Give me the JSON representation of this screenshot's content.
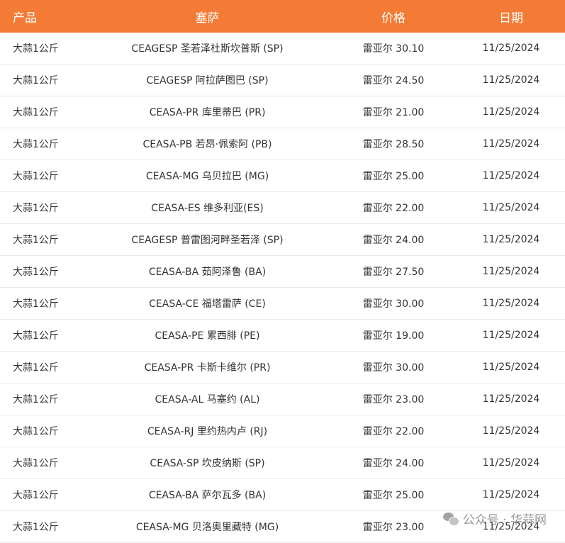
{
  "table": {
    "headers": {
      "product": "产品",
      "market": "塞萨",
      "price": "价格",
      "date": "日期"
    },
    "rows": [
      {
        "product": "大蒜1公斤",
        "market": "CEAGESP 圣若泽杜斯坎普斯 (SP)",
        "price": "雷亚尔 30.10",
        "date": "11/25/2024"
      },
      {
        "product": "大蒜1公斤",
        "market": "CEAGESP 阿拉萨图巴 (SP)",
        "price": "雷亚尔 24.50",
        "date": "11/25/2024"
      },
      {
        "product": "大蒜1公斤",
        "market": "CEASA-PR 库里蒂巴 (PR)",
        "price": "雷亚尔 21.00",
        "date": "11/25/2024"
      },
      {
        "product": "大蒜1公斤",
        "market": "CEASA-PB 若昂·佩索阿 (PB)",
        "price": "雷亚尔 28.50",
        "date": "11/25/2024"
      },
      {
        "product": "大蒜1公斤",
        "market": "CEASA-MG 乌贝拉巴 (MG)",
        "price": "雷亚尔 25.00",
        "date": "11/25/2024"
      },
      {
        "product": "大蒜1公斤",
        "market": "CEASA-ES 维多利亚(ES)",
        "price": "雷亚尔 22.00",
        "date": "11/25/2024"
      },
      {
        "product": "大蒜1公斤",
        "market": "CEAGESP 普雷图河畔圣若泽 (SP)",
        "price": "雷亚尔 24.00",
        "date": "11/25/2024"
      },
      {
        "product": "大蒜1公斤",
        "market": "CEASA-BA 茹阿泽鲁 (BA)",
        "price": "雷亚尔 27.50",
        "date": "11/25/2024"
      },
      {
        "product": "大蒜1公斤",
        "market": "CEASA-CE 福塔雷萨 (CE)",
        "price": "雷亚尔 30.00",
        "date": "11/25/2024"
      },
      {
        "product": "大蒜1公斤",
        "market": "CEASA-PE 累西腓 (PE)",
        "price": "雷亚尔 19.00",
        "date": "11/25/2024"
      },
      {
        "product": "大蒜1公斤",
        "market": "CEASA-PR 卡斯卡维尔 (PR)",
        "price": "雷亚尔 30.00",
        "date": "11/25/2024"
      },
      {
        "product": "大蒜1公斤",
        "market": "CEASA-AL 马塞约 (AL)",
        "price": "雷亚尔 23.00",
        "date": "11/25/2024"
      },
      {
        "product": "大蒜1公斤",
        "market": "CEASA-RJ 里约热内卢 (RJ)",
        "price": "雷亚尔 22.00",
        "date": "11/25/2024"
      },
      {
        "product": "大蒜1公斤",
        "market": "CEASA-SP 坎皮纳斯 (SP)",
        "price": "雷亚尔 24.00",
        "date": "11/25/2024"
      },
      {
        "product": "大蒜1公斤",
        "market": "CEASA-BA 萨尔瓦多 (BA)",
        "price": "雷亚尔 25.00",
        "date": "11/25/2024"
      },
      {
        "product": "大蒜1公斤",
        "market": "CEASA-MG 贝洛奥里藏特 (MG)",
        "price": "雷亚尔 23.00",
        "date": "11/25/2024"
      }
    ]
  },
  "watermark": {
    "text": "公众号 · 华蒜网",
    "icon": "wechat-icon"
  },
  "colors": {
    "header_bg": "#f47b35",
    "header_text": "#ffffff",
    "row_text": "#333333",
    "row_border": "#ebebeb"
  }
}
